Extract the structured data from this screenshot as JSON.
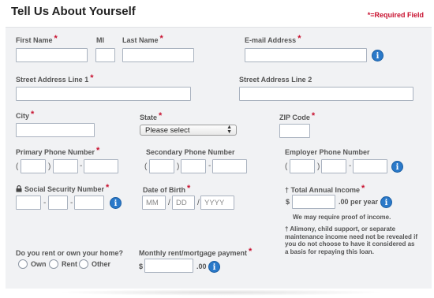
{
  "header": {
    "title": "Tell Us About Yourself",
    "required_note": "*=Required Field"
  },
  "required_star": "*",
  "labels": {
    "first_name": "First Name",
    "mi": "MI",
    "last_name": "Last Name",
    "email": "E-mail Address",
    "street1": "Street Address Line 1",
    "street2": "Street Address Line 2",
    "city": "City",
    "state": "State",
    "zip": "ZIP Code",
    "primary_phone": "Primary Phone Number",
    "secondary_phone": "Secondary Phone Number",
    "employer_phone": "Employer Phone Number",
    "ssn": "Social Security Number",
    "dob": "Date of Birth",
    "income": "† Total Annual Income",
    "rent_own": "Do you rent or own your home?",
    "payment": "Monthly rent/mortgage payment"
  },
  "state_select": {
    "selected": "Please select"
  },
  "phone_symbols": {
    "open": "(",
    "close": ")",
    "dash": "-"
  },
  "dob": {
    "mm": "MM",
    "dd": "DD",
    "yyyy": "YYYY",
    "slash": "/"
  },
  "income": {
    "currency": "$",
    "suffix": ".00 per year"
  },
  "payment": {
    "currency": "$",
    "suffix": ".00"
  },
  "notes": {
    "proof": "We may require proof of income.",
    "alimony_1": "† Alimony, child support, or separate",
    "alimony_2": "maintenance income need not be revealed if",
    "alimony_3": "you do not choose to have it considered as",
    "alimony_4": "a basis for repaying this loan."
  },
  "radio_options": [
    "Own",
    "Rent",
    "Other"
  ],
  "info_glyph": "i",
  "icons": {
    "info": "info-icon",
    "lock": "lock-icon"
  },
  "colors": {
    "required": "#c8102e",
    "info": "#2a79c9",
    "panel": "#f1f2f4"
  }
}
